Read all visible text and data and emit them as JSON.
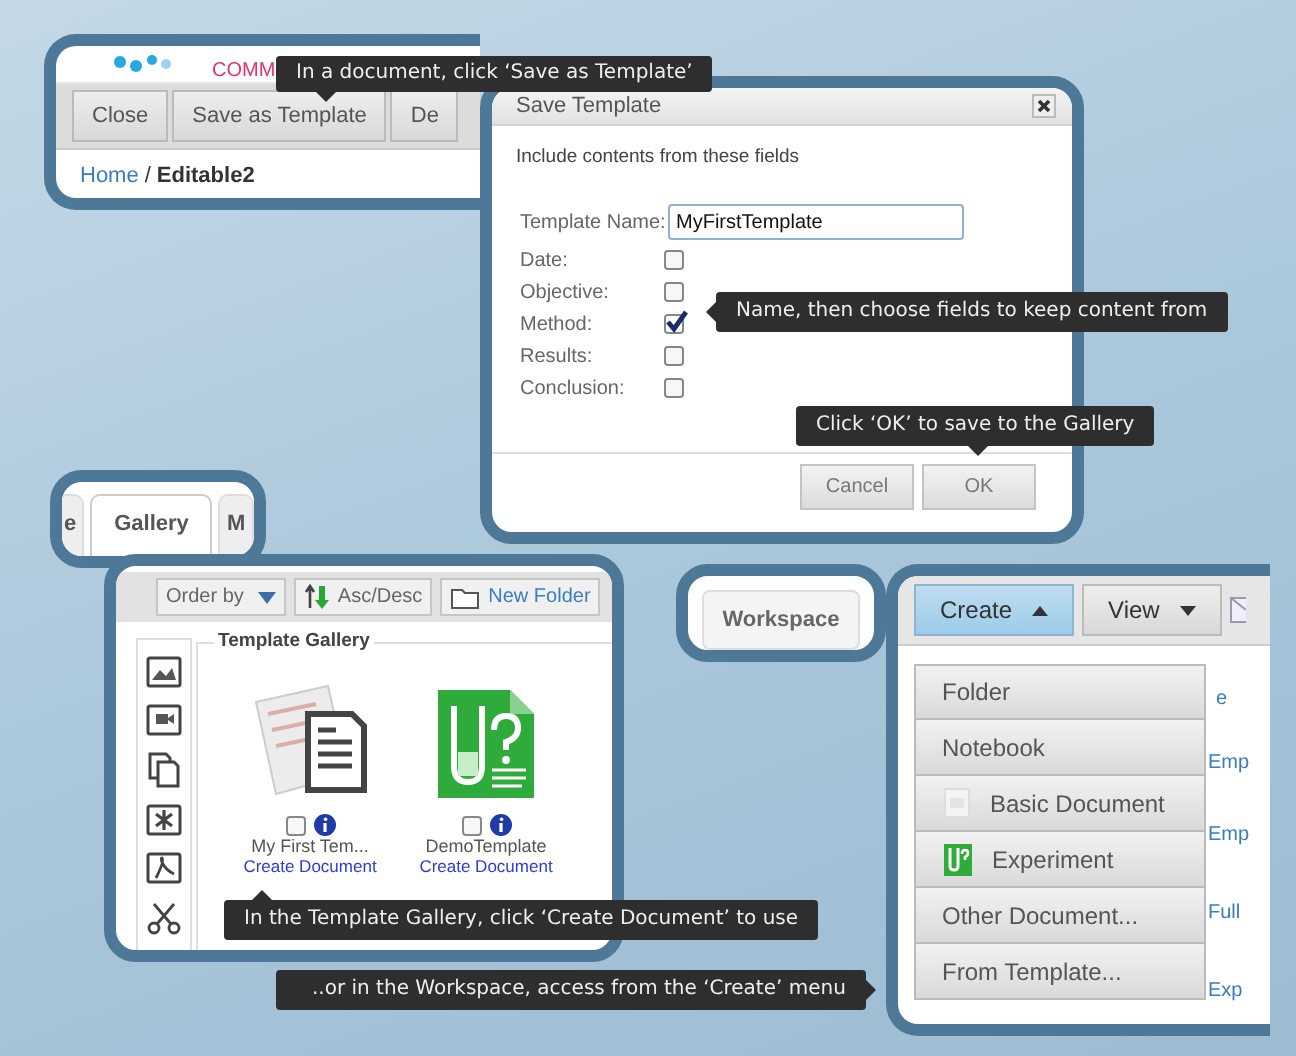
{
  "doc_panel": {
    "logo_text": "COMM",
    "toolbar": [
      {
        "label": "Close"
      },
      {
        "label": "Save as Template"
      },
      {
        "label": "De"
      }
    ],
    "breadcrumb": {
      "link": "Home",
      "separator": "/",
      "current": "Editable2"
    }
  },
  "dialog": {
    "title": "Save Template",
    "intro": "Include contents from these fields",
    "name_label": "Template Name:",
    "name_value": "MyFirstTemplate",
    "fields": [
      {
        "label": "Date:",
        "checked": false
      },
      {
        "label": "Objective:",
        "checked": false
      },
      {
        "label": "Method:",
        "checked": true
      },
      {
        "label": "Results:",
        "checked": false
      },
      {
        "label": "Conclusion:",
        "checked": false
      }
    ],
    "buttons": [
      "Cancel",
      "OK"
    ]
  },
  "tabs": [
    {
      "label": "e",
      "selected": false
    },
    {
      "label": "Gallery",
      "selected": true
    },
    {
      "label": "M",
      "selected": false
    }
  ],
  "gallery": {
    "order_by": "Order by",
    "sort": "Asc/Desc",
    "new_folder": "New Folder",
    "title": "Template Gallery",
    "templates": [
      {
        "kind": "document",
        "name": "My First Tem...",
        "link": "Create Document",
        "checked": false
      },
      {
        "kind": "experiment",
        "name": "DemoTemplate",
        "link": "Create Document",
        "checked": false
      }
    ]
  },
  "workspace_tab": {
    "label": "Workspace"
  },
  "create_panel": {
    "buttons": [
      {
        "label": "Create",
        "selected": true
      },
      {
        "label": "View",
        "selected": false
      }
    ],
    "menu": [
      {
        "label": "Folder",
        "kind": "plain"
      },
      {
        "label": "Notebook",
        "kind": "plain"
      },
      {
        "label": "Basic Document",
        "kind": "document"
      },
      {
        "label": "Experiment",
        "kind": "experiment"
      },
      {
        "label": "Other Document...",
        "kind": "plain"
      },
      {
        "label": "From Template...",
        "kind": "plain"
      }
    ],
    "behind_links": [
      "e",
      "Emp",
      "Emp",
      "Full",
      "Exp"
    ]
  },
  "tooltips": [
    "In a document, click ‘Save as Template’",
    "Name, then choose fields to keep content from",
    "Click ‘OK’ to save to the Gallery",
    "In the Template Gallery, click ‘Create Document’ to use",
    "..or in the Workspace, access from the ‘Create’ menu"
  ]
}
